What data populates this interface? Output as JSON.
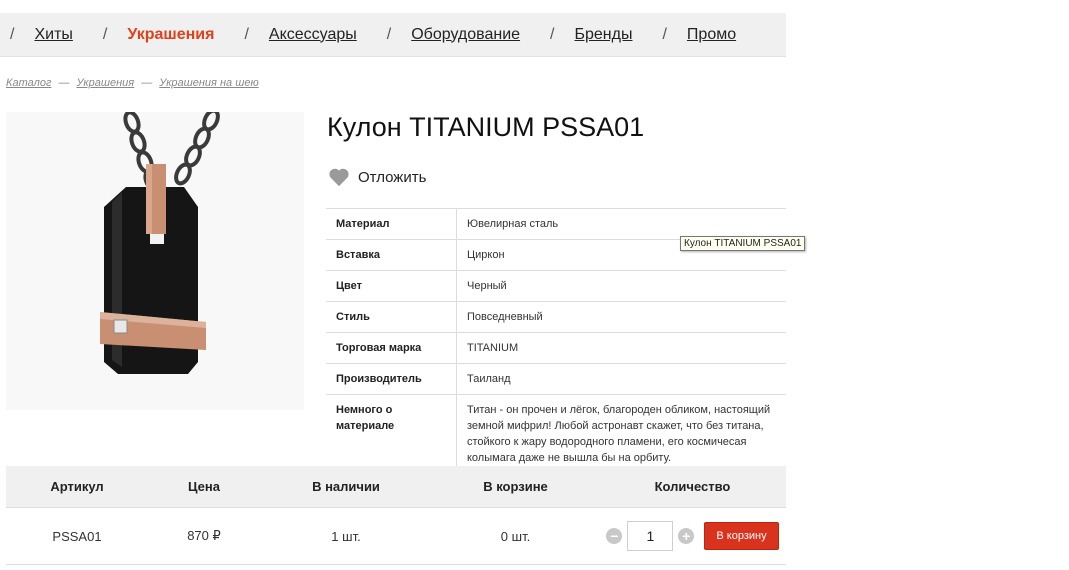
{
  "nav": {
    "separator": "/",
    "items": [
      "Хиты",
      "Украшения",
      "Аксессуары",
      "Оборудование",
      "Бренды",
      "Промо"
    ],
    "active_index": 1,
    "active_color": "#e0401a"
  },
  "breadcrumb": {
    "items": [
      "Каталог",
      "Украшения",
      "Украшения на шею"
    ],
    "divider": "—"
  },
  "product": {
    "title": "Кулон TITANIUM PSSA01",
    "image_icon": "pendant-image",
    "wishlist_label": "Отложить",
    "wishlist_icon": "heart-icon",
    "tooltip": "Кулон TITANIUM PSSA01"
  },
  "specs": [
    {
      "key": "Материал",
      "value": "Ювелирная сталь"
    },
    {
      "key": "Вставка",
      "value": "Циркон"
    },
    {
      "key": "Цвет",
      "value": "Черный"
    },
    {
      "key": "Стиль",
      "value": "Повседневный"
    },
    {
      "key": "Торговая марка",
      "value": "TITANIUM"
    },
    {
      "key": "Производитель",
      "value": "Таиланд"
    },
    {
      "key": "Немного о материале",
      "value": "Титан - он прочен и лёгок, благороден обликом, настоящий земной мифрил! Любой астронавт скажет, что без титана, стойкого к жару водородного пламени, его космичесая колымага даже не вышла бы на орбиту."
    }
  ],
  "offer": {
    "headers": {
      "sku": "Артикул",
      "price": "Цена",
      "stock": "В наличии",
      "in_cart": "В корзине",
      "quantity": "Количество"
    },
    "row": {
      "sku": "PSSA01",
      "price": "870 ₽",
      "stock": "1 шт.",
      "in_cart": "0 шт.",
      "quantity": "1"
    },
    "minus_label": "−",
    "plus_label": "+",
    "cart_button": "В корзину",
    "cart_button_color": "#d9321d"
  }
}
